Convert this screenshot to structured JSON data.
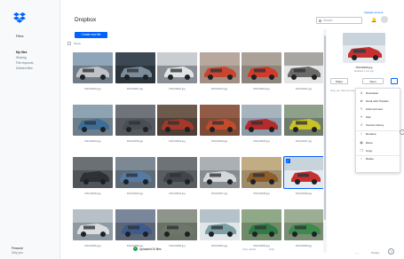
{
  "sidebar": {
    "files_label": "Files",
    "items": [
      "My files",
      "Sharing",
      "File requests",
      "Deleted files"
    ],
    "account_name": "Personal",
    "account_sub": "Only you"
  },
  "main": {
    "title": "Dropbox",
    "create_label": "Create new file",
    "select_label": "Name"
  },
  "top": {
    "search_placeholder": "Search",
    "upgrade": "Upgrade account"
  },
  "files": [
    {
      "name": "DSC03001.jpg",
      "color": "#8fa6b8",
      "car": "#c0c4c8",
      "bg": "#6f7b86",
      "selected": false
    },
    {
      "name": "DSC03007.jpg",
      "color": "#3d4855",
      "car": "#7b8b99",
      "bg": "#2b333b",
      "selected": false
    },
    {
      "name": "DSC03010.jpg",
      "color": "#c9ccd0",
      "car": "#e1e3e5",
      "bg": "#8a8f95",
      "selected": false
    },
    {
      "name": "DSC03012.jpg",
      "color": "#b8a79c",
      "car": "#c8452f",
      "bg": "#9f8f85",
      "selected": false
    },
    {
      "name": "DSC03019.jpg",
      "color": "#aaa299",
      "car": "#d23a2a",
      "bg": "#8c857c",
      "selected": false
    },
    {
      "name": "DSC03021.jpg",
      "color": "#a8a6a3",
      "car": "#6c6b6a",
      "bg": "#e5e5e5",
      "selected": false
    },
    {
      "name": "DSC03024.jpg",
      "color": "#8ea3b2",
      "car": "#3c6e9a",
      "bg": "#6d7e8a",
      "selected": false
    },
    {
      "name": "DSC03026.jpg",
      "color": "#6f747a",
      "car": "#494e55",
      "bg": "#55595e",
      "selected": false
    },
    {
      "name": "DSC03029.jpg",
      "color": "#6c5a4d",
      "car": "#a53827",
      "bg": "#4d3f35",
      "selected": false
    },
    {
      "name": "DSC03030.jpg",
      "color": "#905c48",
      "car": "#c44b2a",
      "bg": "#7c4b37",
      "selected": false
    },
    {
      "name": "DSC03035.jpg",
      "color": "#a7b3bd",
      "car": "#b52b2b",
      "bg": "#8a9aa7",
      "selected": false
    },
    {
      "name": "DSC03037.jpg",
      "color": "#8fa08a",
      "car": "#c8c226",
      "bg": "#6f7c6a",
      "selected": false
    },
    {
      "name": "DSC03040.jpg",
      "color": "#6b7075",
      "car": "#2d3035",
      "bg": "#50555a",
      "selected": false
    },
    {
      "name": "DSC03042.jpg",
      "color": "#7c8894",
      "car": "#557aa3",
      "bg": "#5e6a75",
      "selected": false
    },
    {
      "name": "DSC03044.jpg",
      "color": "#6e7378",
      "car": "#42464b",
      "bg": "#585d62",
      "selected": false
    },
    {
      "name": "DSC03047.jpg",
      "color": "#aab0b3",
      "car": "#d5d8da",
      "bg": "#868c90",
      "selected": false
    },
    {
      "name": "DSC03048.jpg",
      "color": "#c2ac84",
      "car": "#8e5d2a",
      "bg": "#9d8b69",
      "selected": false
    },
    {
      "name": "DSC03049.jpg",
      "color": "#c9d3dc",
      "car": "#c83030",
      "bg": "#e4e9ee",
      "selected": true
    },
    {
      "name": "DSC03052.jpg",
      "color": "#b7c0c7",
      "car": "#d9dde0",
      "bg": "#8f9aa3",
      "selected": false
    },
    {
      "name": "DSC03056.jpg",
      "color": "#7a869a",
      "car": "#3f5a8c",
      "bg": "#5b6677",
      "selected": false
    },
    {
      "name": "DSC03058.jpg",
      "color": "#8d958b",
      "car": "#6d7668",
      "bg": "#6a7268",
      "selected": false
    },
    {
      "name": "DSC03062.jpg",
      "color": "#b6c2c9",
      "car": "#7da0a4",
      "bg": "#dfe5e8",
      "selected": false
    },
    {
      "name": "DSC03065.jpg",
      "color": "#8fa886",
      "car": "#2f7a45",
      "bg": "#6f8a68",
      "selected": false
    },
    {
      "name": "DSC03068.jpg",
      "color": "#9bae94",
      "car": "#3b8b4d",
      "bg": "#7a8c74",
      "selected": false
    }
  ],
  "preview": {
    "name": "DSC03049.jpg",
    "meta": "Modified 1 min ago",
    "share": "Share",
    "open": "Open",
    "more": "...",
    "only_you": "Only you have access"
  },
  "menu": [
    {
      "icon": "download-icon",
      "glyph": "⬇",
      "label": "Download"
    },
    {
      "icon": "transfer-icon",
      "glyph": "⇄",
      "label": "Send with Transfer"
    },
    {
      "icon": "comment-icon",
      "glyph": "✎",
      "label": "Add comment"
    },
    {
      "icon": "pin-icon",
      "glyph": "✦",
      "label": "Star"
    },
    {
      "icon": "history-icon",
      "glyph": "↺",
      "label": "Version history"
    },
    {
      "icon": "rename-icon",
      "glyph": "I",
      "label": "Rename"
    },
    {
      "icon": "move-icon",
      "glyph": "▣",
      "label": "Move"
    },
    {
      "icon": "copy-icon",
      "glyph": "❐",
      "label": "Copy"
    },
    {
      "icon": "delete-icon",
      "glyph": "▪",
      "label": "Delete"
    }
  ],
  "status": {
    "toast": "Uploaded 24 files",
    "view_details": "View details",
    "hide": "Hide",
    "privacy": "Privacy",
    "help": "?"
  }
}
